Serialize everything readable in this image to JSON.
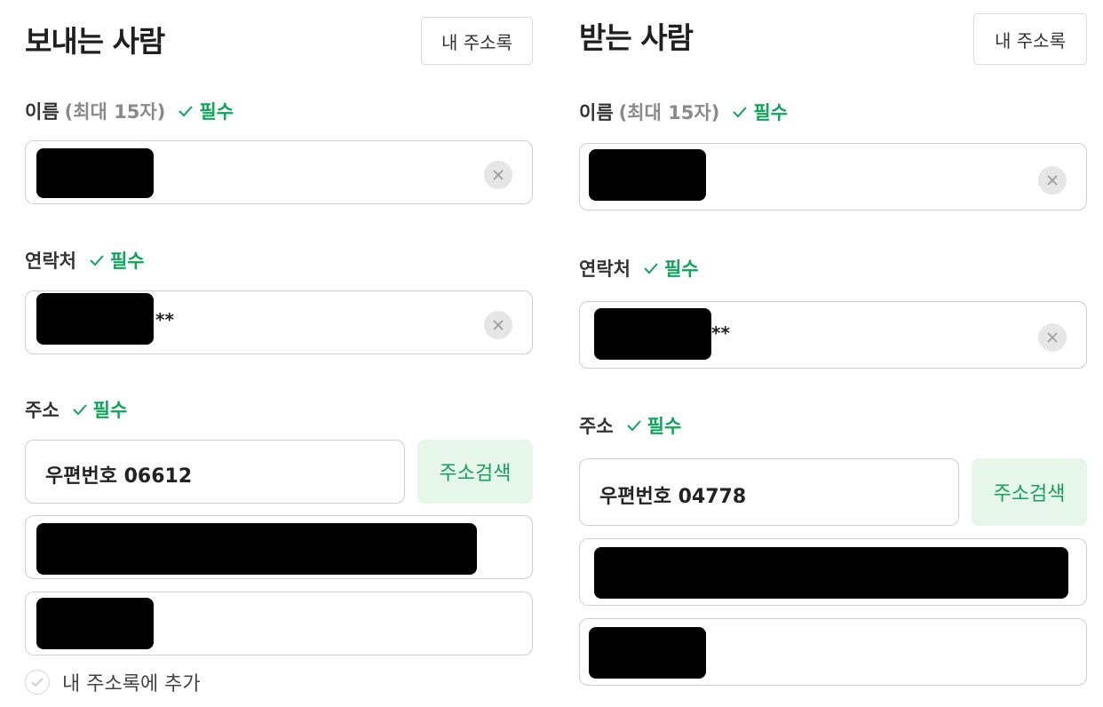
{
  "sender": {
    "title": "보내는 사람",
    "address_book_button": "내 주소록",
    "name_label": "이름",
    "name_hint": "(최대 15자)",
    "required": "필수",
    "phone_label": "연락처",
    "phone_masked_suffix": "**",
    "address_label": "주소",
    "postal_code": "우편번호 06612",
    "address_search_button": "주소검색",
    "add_to_book_label": "내 주소록에 추가"
  },
  "receiver": {
    "title": "받는 사람",
    "address_book_button": "내 주소록",
    "name_label": "이름",
    "name_hint": "(최대 15자)",
    "required": "필수",
    "phone_label": "연락처",
    "phone_masked_suffix": "**",
    "address_label": "주소",
    "postal_code": "우편번호 04778",
    "address_search_button": "주소검색"
  },
  "colors": {
    "required_green": "#0ea45a",
    "search_button_bg": "#e6f6ea",
    "search_button_text": "#16a05a",
    "redaction": "#000000"
  },
  "icons": {
    "required": "check-icon",
    "clear": "close-circle-icon",
    "add_checkbox": "check-circle-icon"
  }
}
